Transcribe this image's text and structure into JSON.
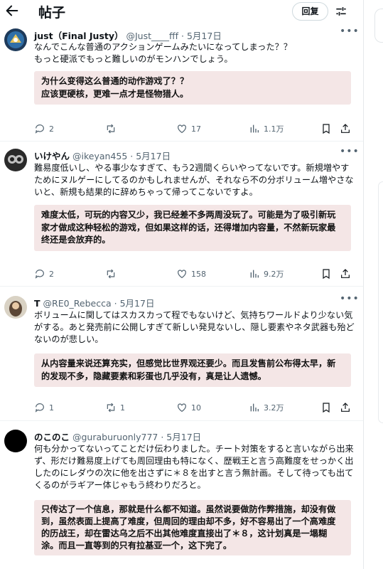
{
  "header": {
    "title": "帖子",
    "reply_label": "回复"
  },
  "posts": [
    {
      "name": "just（Final Justy）",
      "handle": "@Just____fff",
      "date": "· 5月17日",
      "text": "なんでこんな普通のアクションゲームみたいになってしまった？？\nもっと硬派でもっと難しいのがモンハンでしょう。",
      "translation": "为什么变得这么普通的动作游戏了？？\n应该更硬核，更难一点才是怪物猎人。",
      "replies": "2",
      "reposts": "",
      "likes": "17",
      "views": "1.1万"
    },
    {
      "name": "いけやん",
      "handle": "@ikeyan455",
      "date": "· 5月17日",
      "text": "難易度低いし、やる事少なすぎて、もう2週間くらいやってないです。新規増やすためにヌルゲーにしてるのかもしれませんが、それなら不の分ボリューム増やさないと、新規も結果的に辞めちゃって帰ってこないですよ。",
      "translation": "难度太低，可玩的内容又少，我已经差不多两周没玩了。可能是为了吸引新玩家才做成这种轻松的游戏，但如果这样的话，还得增加内容量，不然新玩家最终还是会放弃的。",
      "replies": "2",
      "reposts": "",
      "likes": "158",
      "views": "9.2万"
    },
    {
      "name": "T",
      "handle": "@RE0_Rebecca",
      "date": "· 5月17日",
      "text": "ボリュームに関してはスカスカって程でもないけど、気持ちワールドより少ない気がする。あと発売前に公開しすぎて新しい発見ないし、隠し要素やネタ武器も殆どないのが悲しい。",
      "translation": "从内容量来说还算充实，但感觉比世界观还要少。而且发售前公布得太早，新的发现不多，隐藏要素和彩蛋也几乎没有，真是让人遗憾。",
      "replies": "1",
      "reposts": "1",
      "likes": "10",
      "views": "3.2万"
    },
    {
      "name": "のこのこ",
      "handle": "@guraburuonly777",
      "date": "· 5月17日",
      "text": "何も分かってないってことだけ伝わりました。チート対策をすると言いながら出来ず、形だけ難易度上げても周回理由も特になく、歴戦王と言う高難度をせっかく出したのにレダウの次に他を出さずに＊８を出すと言う無計画。そして待っても出てくるのがラギアー体じゃもう終わりだろと。",
      "translation": "只传达了一个信息，那就是什么都不知道。虽然说要做防作弊措施，却没有做到，虽然表面上提高了难度，但周回的理由却不多，好不容易出了一个高难度的历战王，却在雷达乌之后不出其他难度直接出了＊８，这计划真是一塌糊涂。而且一直等到的只有拉基亚一个，这下完了。"
    }
  ],
  "icons": [
    "back-arrow-icon",
    "settings-icon",
    "more-icon",
    "reply-icon",
    "repost-icon",
    "like-icon",
    "views-icon",
    "bookmark-icon",
    "share-icon"
  ]
}
